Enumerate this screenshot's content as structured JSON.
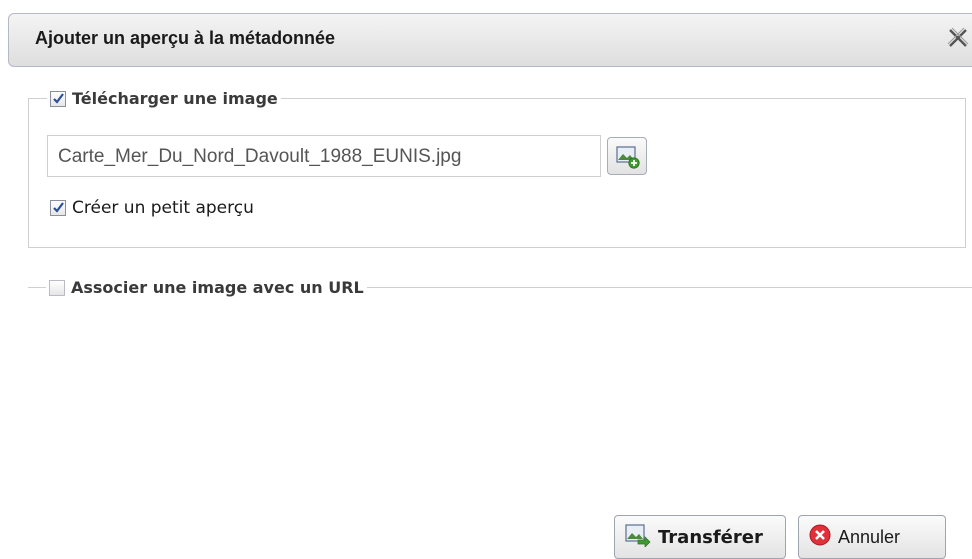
{
  "dialog": {
    "title": "Ajouter un aperçu à la métadonnée"
  },
  "upload_section": {
    "legend": "Télécharger une image",
    "checked": true,
    "file_value": "Carte_Mer_Du_Nord_Davoult_1988_EUNIS.jpg",
    "thumbnail_label": "Créer un petit aperçu",
    "thumbnail_checked": true
  },
  "url_section": {
    "legend": "Associer une image avec un URL",
    "checked": false
  },
  "buttons": {
    "transfer_label": "Transférer",
    "cancel_label": "Annuler"
  },
  "icons": {
    "close": "close-icon",
    "browse": "image-add-icon",
    "transfer": "image-arrow-icon",
    "cancel": "cancel-icon"
  },
  "colors": {
    "cancel_icon": "#e0303a",
    "checkmark": "#2a4f9a",
    "image_icon": "#4a8a3a"
  }
}
